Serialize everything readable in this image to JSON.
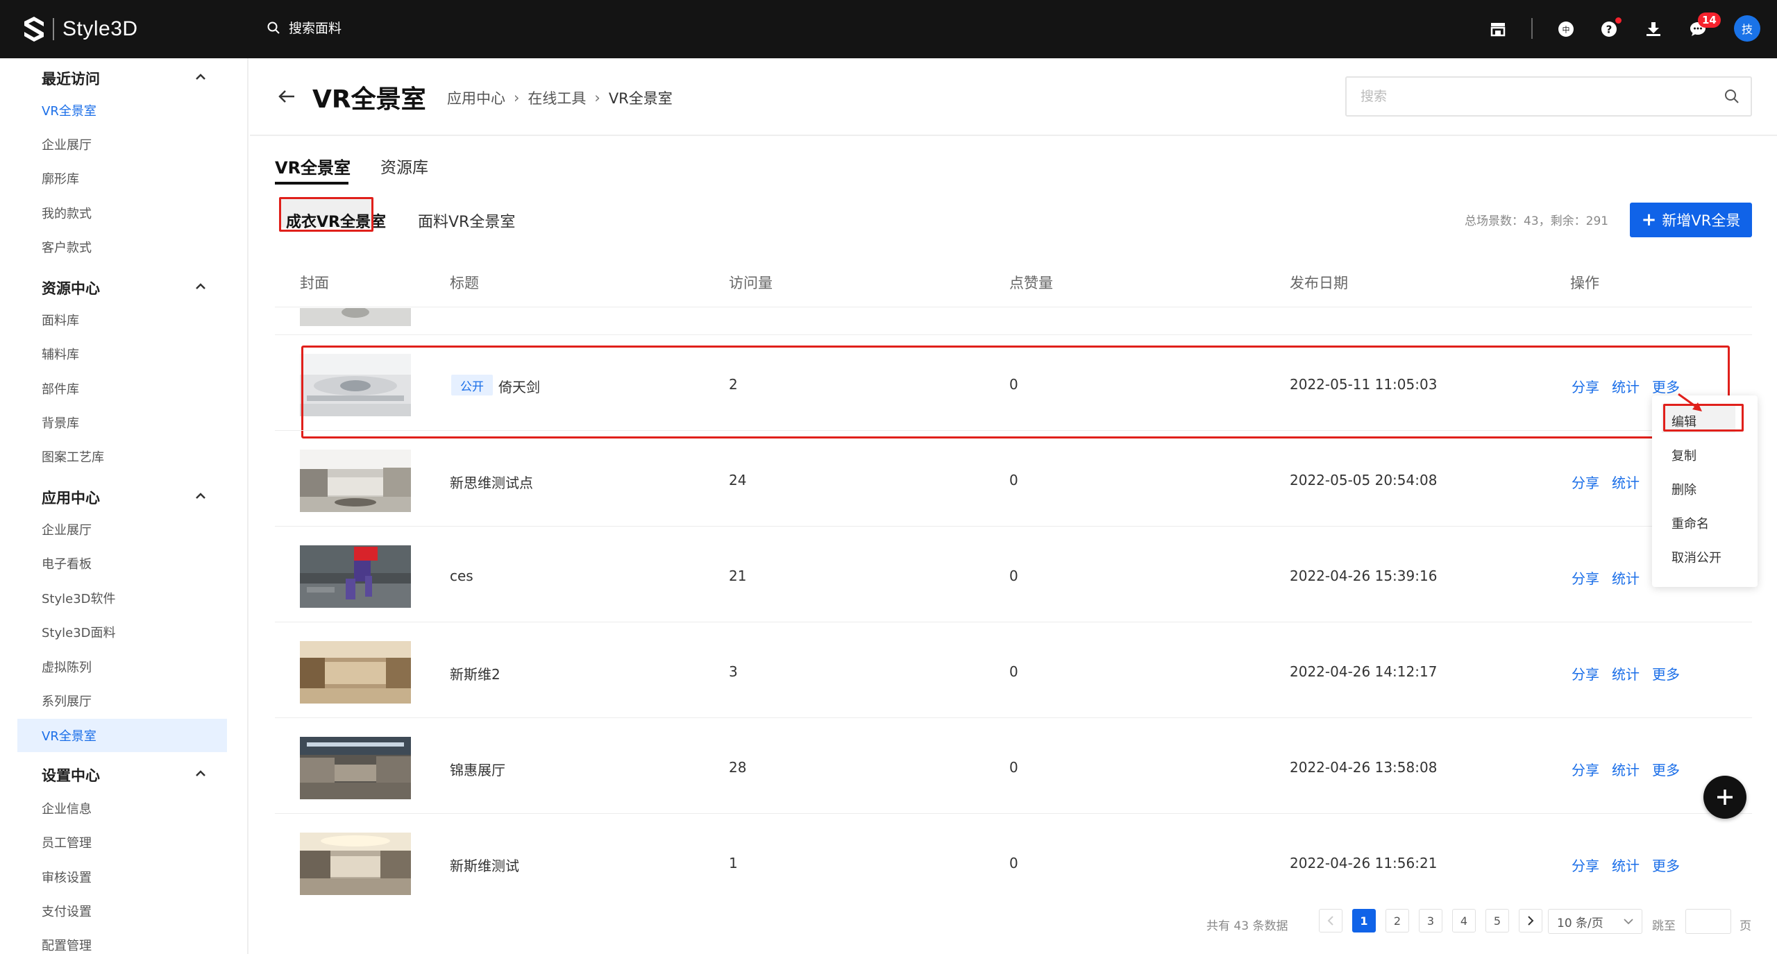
{
  "topbar": {
    "logo_text": "Style3D",
    "search_placeholder": "搜索面料",
    "message_badge": "14",
    "avatar_text": "技"
  },
  "sidebar": {
    "groups": [
      {
        "title": "最近访问",
        "items": [
          "VR全景室",
          "企业展厅",
          "廓形库",
          "我的款式",
          "客户款式"
        ]
      },
      {
        "title": "资源中心",
        "items": [
          "面料库",
          "辅料库",
          "部件库",
          "背景库",
          "图案工艺库"
        ]
      },
      {
        "title": "应用中心",
        "items": [
          "企业展厅",
          "电子看板",
          "Style3D软件",
          "Style3D面料",
          "虚拟陈列",
          "系列展厅",
          "VR全景室"
        ]
      },
      {
        "title": "设置中心",
        "items": [
          "企业信息",
          "员工管理",
          "审核设置",
          "支付设置",
          "配置管理"
        ]
      }
    ]
  },
  "header": {
    "title": "VR全景室",
    "breadcrumb": [
      "应用中心",
      "在线工具",
      "VR全景室"
    ],
    "search_placeholder": "搜索"
  },
  "tabs": [
    "VR全景室",
    "资源库"
  ],
  "subtabs": [
    "成衣VR全景室",
    "面料VR全景室"
  ],
  "stats": "总场景数：43，剩余：291",
  "add_button": "新增VR全景",
  "table": {
    "columns": [
      "封面",
      "标题",
      "访问量",
      "点赞量",
      "发布日期",
      "操作"
    ],
    "rows": [
      {
        "public_tag": "公开",
        "title": "倚天剑",
        "visits": "2",
        "likes": "0",
        "date": "2022-05-11 11:05:03"
      },
      {
        "public_tag": "",
        "title": "新思维测试点",
        "visits": "24",
        "likes": "0",
        "date": "2022-05-05 20:54:08"
      },
      {
        "public_tag": "",
        "title": "ces",
        "visits": "21",
        "likes": "0",
        "date": "2022-04-26 15:39:16"
      },
      {
        "public_tag": "",
        "title": "新斯维2",
        "visits": "3",
        "likes": "0",
        "date": "2022-04-26 14:12:17"
      },
      {
        "public_tag": "",
        "title": "锦惠展厅",
        "visits": "28",
        "likes": "0",
        "date": "2022-04-26 13:58:08"
      },
      {
        "public_tag": "",
        "title": "新斯维测试",
        "visits": "1",
        "likes": "0",
        "date": "2022-04-26 11:56:21"
      }
    ],
    "ops": {
      "share": "分享",
      "stats": "统计",
      "more": "更多"
    }
  },
  "dropdown": [
    "编辑",
    "复制",
    "删除",
    "重命名",
    "取消公开"
  ],
  "pagination": {
    "total": "共有 43 条数据",
    "pages": [
      "1",
      "2",
      "3",
      "4",
      "5"
    ],
    "page_size": "10 条/页",
    "jump_label": "跳至",
    "jump_unit": "页"
  }
}
